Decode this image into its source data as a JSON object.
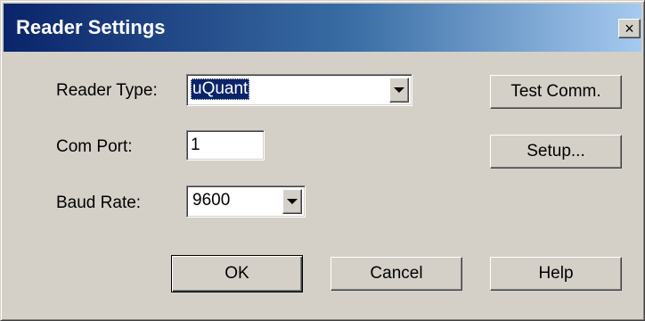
{
  "window": {
    "title": "Reader Settings",
    "close_glyph": "×",
    "close_icon": "close-icon"
  },
  "form": {
    "reader_type": {
      "label": "Reader Type:",
      "value": "uQuant",
      "dropdown_icon": "chevron-down-icon"
    },
    "com_port": {
      "label": "Com Port:",
      "value": "1"
    },
    "baud_rate": {
      "label": "Baud Rate:",
      "value": "9600",
      "dropdown_icon": "chevron-down-icon"
    }
  },
  "side_buttons": {
    "test_comm": "Test Comm.",
    "setup": "Setup..."
  },
  "footer_buttons": {
    "ok": "OK",
    "cancel": "Cancel",
    "help": "Help"
  },
  "colors": {
    "title_bar_start": "#0a246a",
    "title_bar_end": "#a6caf0",
    "dialog_face": "#d4d0c8",
    "selection": "#0a246a"
  }
}
